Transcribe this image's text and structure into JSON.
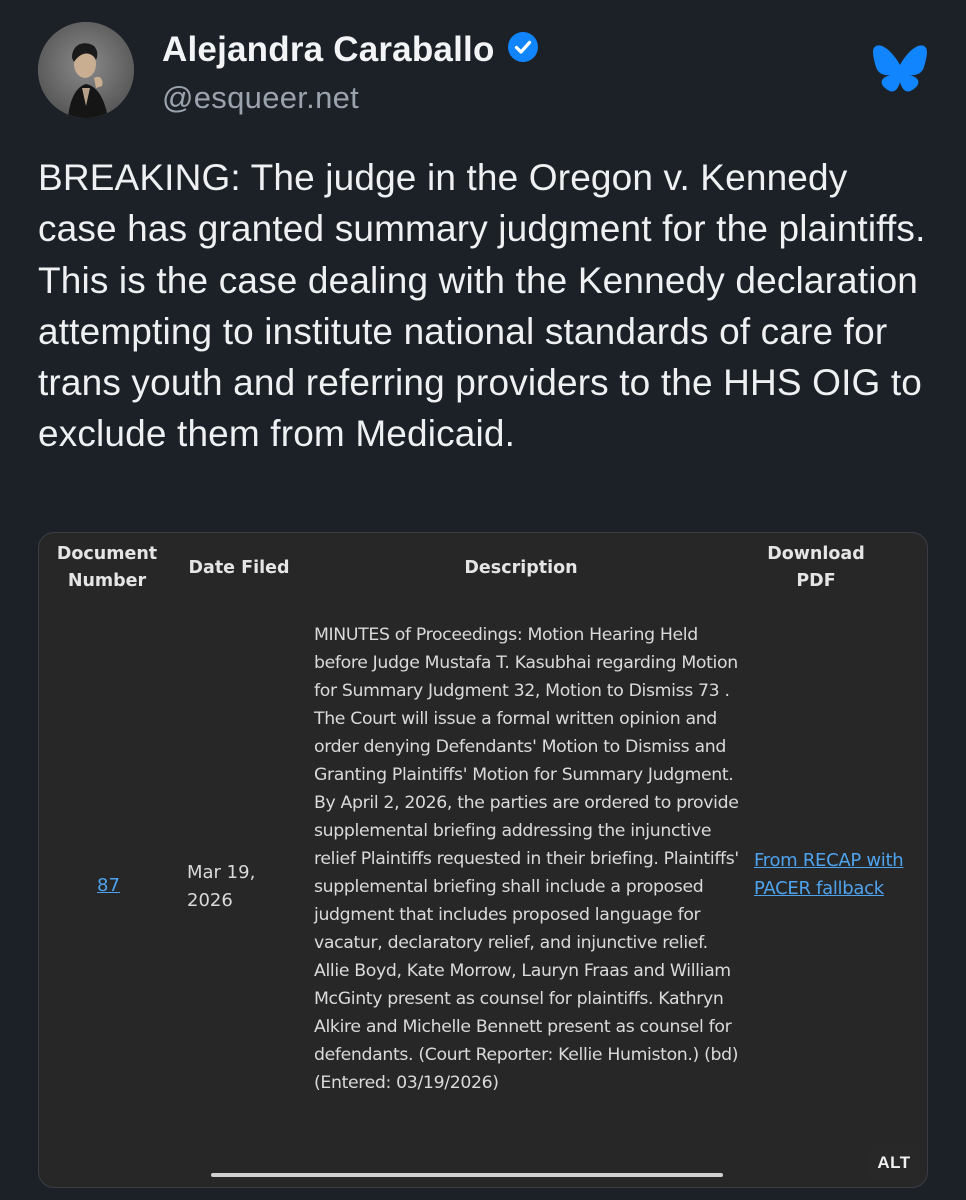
{
  "author": {
    "display_name": "Alejandra Caraballo",
    "handle": "@esqueer.net",
    "verified_icon": "verified-check-icon"
  },
  "app": {
    "logo_icon": "bluesky-butterfly-icon",
    "accent_color": "#1185fe"
  },
  "post": {
    "text": "BREAKING: The judge in the Oregon v. Kennedy case has granted summary judgment for the plaintiffs. This is the case dealing with the Kennedy declaration attempting to institute national standards of care for trans youth and referring providers to the HHS OIG to exclude them from Medicaid."
  },
  "embed": {
    "alt_label": "ALT",
    "table": {
      "headers": {
        "doc_number": "Document Number",
        "date_filed": "Date Filed",
        "description": "Description",
        "download": "Download PDF"
      },
      "row": {
        "doc_number": "87",
        "date_filed": "Mar 19, 2026",
        "description": "MINUTES of Proceedings: Motion Hearing Held before Judge Mustafa T. Kasubhai regarding Motion for Summary Judgment 32, Motion to Dismiss 73 . The Court will issue a formal written opinion and order denying Defendants' Motion to Dismiss and Granting Plaintiffs' Motion for Summary Judgment. By April 2, 2026, the parties are ordered to provide supplemental briefing addressing the injunctive relief Plaintiffs requested in their briefing. Plaintiffs' supplemental briefing shall include a proposed judgment that includes proposed language for vacatur, declaratory relief, and injunctive relief. Allie Boyd, Kate Morrow, Lauryn Fraas and William McGinty present as counsel for plaintiffs. Kathryn Alkire and Michelle Bennett present as counsel for defendants. (Court Reporter: Kellie Humiston.) (bd) (Entered: 03/19/2026)",
        "download": "From RECAP with PACER fallback"
      }
    }
  }
}
